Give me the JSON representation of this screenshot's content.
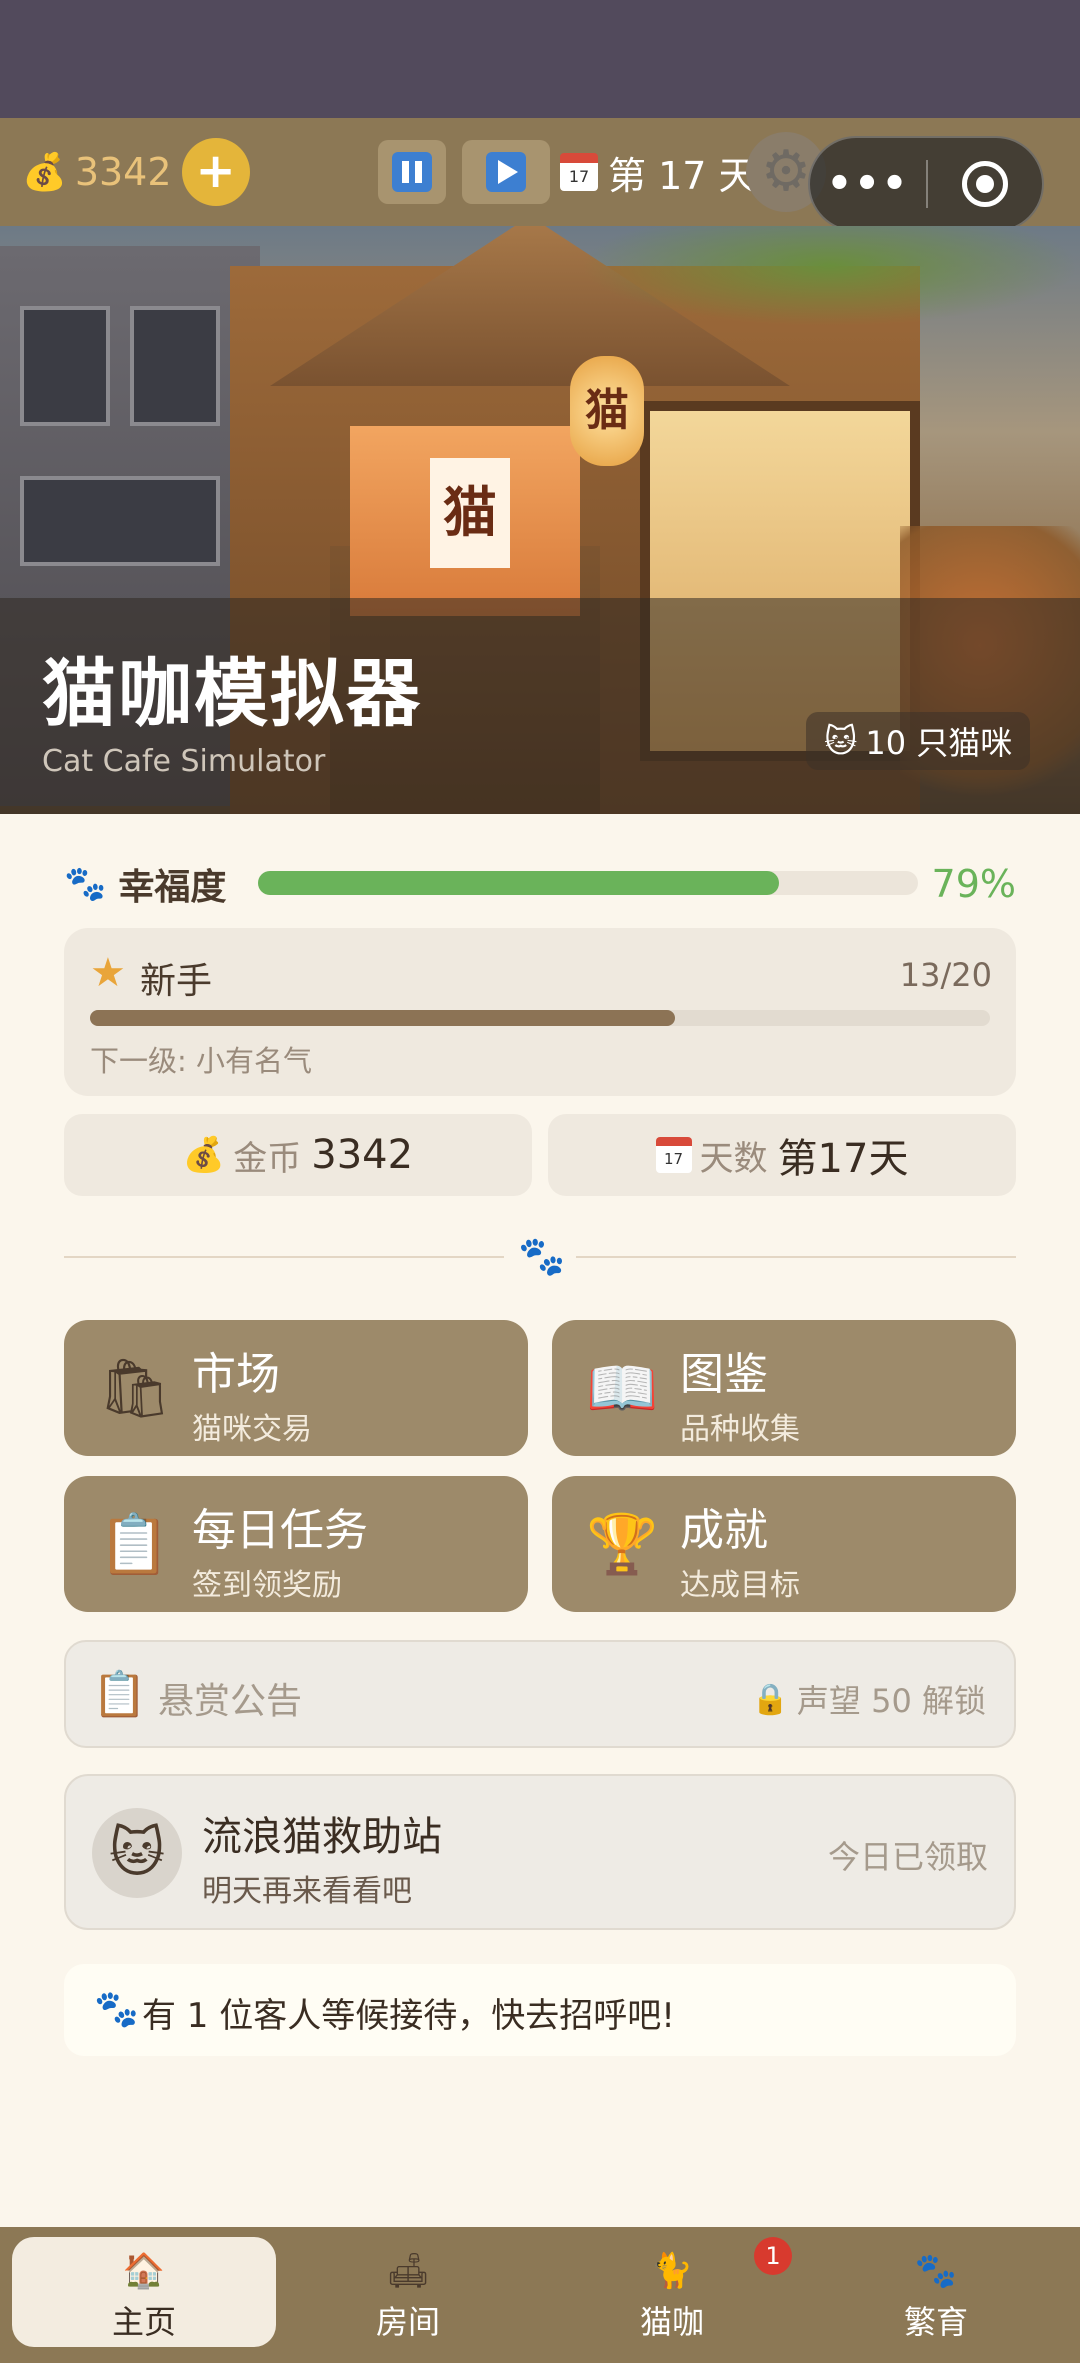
{
  "topbar": {
    "coins": "3342",
    "plus_label": "+",
    "day_label": "第 17 天",
    "calendar_day": "17"
  },
  "hero": {
    "title": "猫咖模拟器",
    "subtitle": "Cat Cafe Simulator",
    "cat_count": "10 只猫咪",
    "sign_char": "猫",
    "lantern_char": "猫"
  },
  "happiness": {
    "label": "幸福度",
    "percent_text": "79%",
    "value": 0.79
  },
  "level": {
    "name": "新手",
    "progress_text": "13/20",
    "value": 0.65,
    "next_label": "下一级: 小有名气"
  },
  "stats": {
    "gold_label": "金币",
    "gold_value": "3342",
    "days_label": "天数",
    "days_value": "第17天",
    "calendar_day": "17"
  },
  "tiles": [
    {
      "title": "市场",
      "subtitle": "猫咪交易",
      "icon": "shopping-bag-icon"
    },
    {
      "title": "图鉴",
      "subtitle": "品种收集",
      "icon": "book-icon"
    },
    {
      "title": "每日任务",
      "subtitle": "签到领奖励",
      "icon": "clipboard-icon"
    },
    {
      "title": "成就",
      "subtitle": "达成目标",
      "icon": "trophy-icon"
    }
  ],
  "bounty": {
    "title": "悬赏公告",
    "lock_text": "声望 50 解锁"
  },
  "rescue": {
    "title": "流浪猫救助站",
    "subtitle": "明天再来看看吧",
    "status": "今日已领取"
  },
  "notice": {
    "text": "有 1 位客人等候接待，快去招呼吧!"
  },
  "tabs": [
    {
      "label": "主页",
      "icon": "home-icon"
    },
    {
      "label": "房间",
      "icon": "room-icon"
    },
    {
      "label": "猫咖",
      "icon": "cafe-icon",
      "badge": "1"
    },
    {
      "label": "繁育",
      "icon": "breeding-icon"
    }
  ],
  "colors": {
    "accent": "#8c7855",
    "happiness": "#6ab35a",
    "badge": "#d83a2e"
  }
}
